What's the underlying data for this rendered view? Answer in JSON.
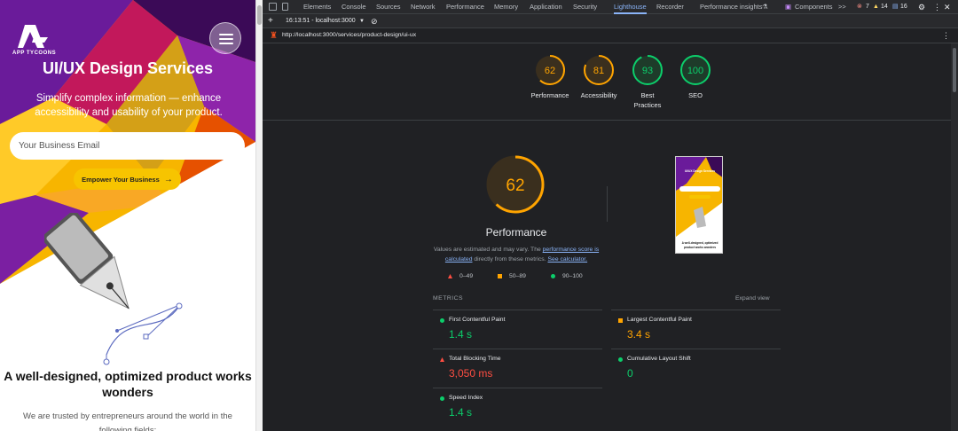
{
  "site": {
    "logo_text": "APP TYCOONS",
    "hero_title": "UI/UX Design Services",
    "hero_subtitle": "Simplify complex information — enhance accessibility and usability of your product.",
    "email_placeholder": "Your Business Email",
    "cta_label": "Empower Your Business",
    "section_title": "A well-designed, optimized product works wonders",
    "section_text": "We are trusted by entrepreneurs around the world in the following fields:"
  },
  "devtools": {
    "tabs": [
      "Elements",
      "Console",
      "Sources",
      "Network",
      "Performance",
      "Memory",
      "Application",
      "Security",
      "Lighthouse",
      "Recorder",
      "Performance insights",
      "Components"
    ],
    "active_tab": "Lighthouse",
    "more_tabs": ">>",
    "errors": "7",
    "warnings": "14",
    "issues": "16",
    "session": "16:13:51 - localhost:3000",
    "url": "http://localhost:3000/services/product-design/ui-ux"
  },
  "scores": [
    {
      "label": "Performance",
      "value": "62",
      "status": "average"
    },
    {
      "label": "Accessibility",
      "value": "81",
      "status": "average"
    },
    {
      "label": "Best Practices",
      "value": "93",
      "status": "pass"
    },
    {
      "label": "SEO",
      "value": "100",
      "status": "pass"
    }
  ],
  "performance": {
    "score": "62",
    "title": "Performance",
    "desc_pre": "Values are estimated and may vary. The",
    "desc_link1": "performance score is calculated",
    "desc_mid": "directly from these metrics.",
    "desc_link2": "See calculator.",
    "legend": [
      "0–49",
      "50–89",
      "90–100"
    ]
  },
  "metrics": {
    "header": "METRICS",
    "expand": "Expand view",
    "items": [
      {
        "name": "First Contentful Paint",
        "value": "1.4 s",
        "status": "pass"
      },
      {
        "name": "Largest Contentful Paint",
        "value": "3.4 s",
        "status": "average"
      },
      {
        "name": "Total Blocking Time",
        "value": "3,050 ms",
        "status": "fail"
      },
      {
        "name": "Cumulative Layout Shift",
        "value": "0",
        "status": "pass"
      },
      {
        "name": "Speed Index",
        "value": "1.4 s",
        "status": "pass"
      }
    ]
  },
  "thumbnail": {
    "title": "UI/UX Design Services",
    "caption": "A well-designed, optimized product works wonders"
  },
  "colors": {
    "pass": "#0cce6b",
    "average": "#ffa400",
    "fail": "#ff4e42",
    "accent": "#8ab4f8",
    "brand_yellow": "#f7c400",
    "brand_purple": "#7a1fa2"
  }
}
